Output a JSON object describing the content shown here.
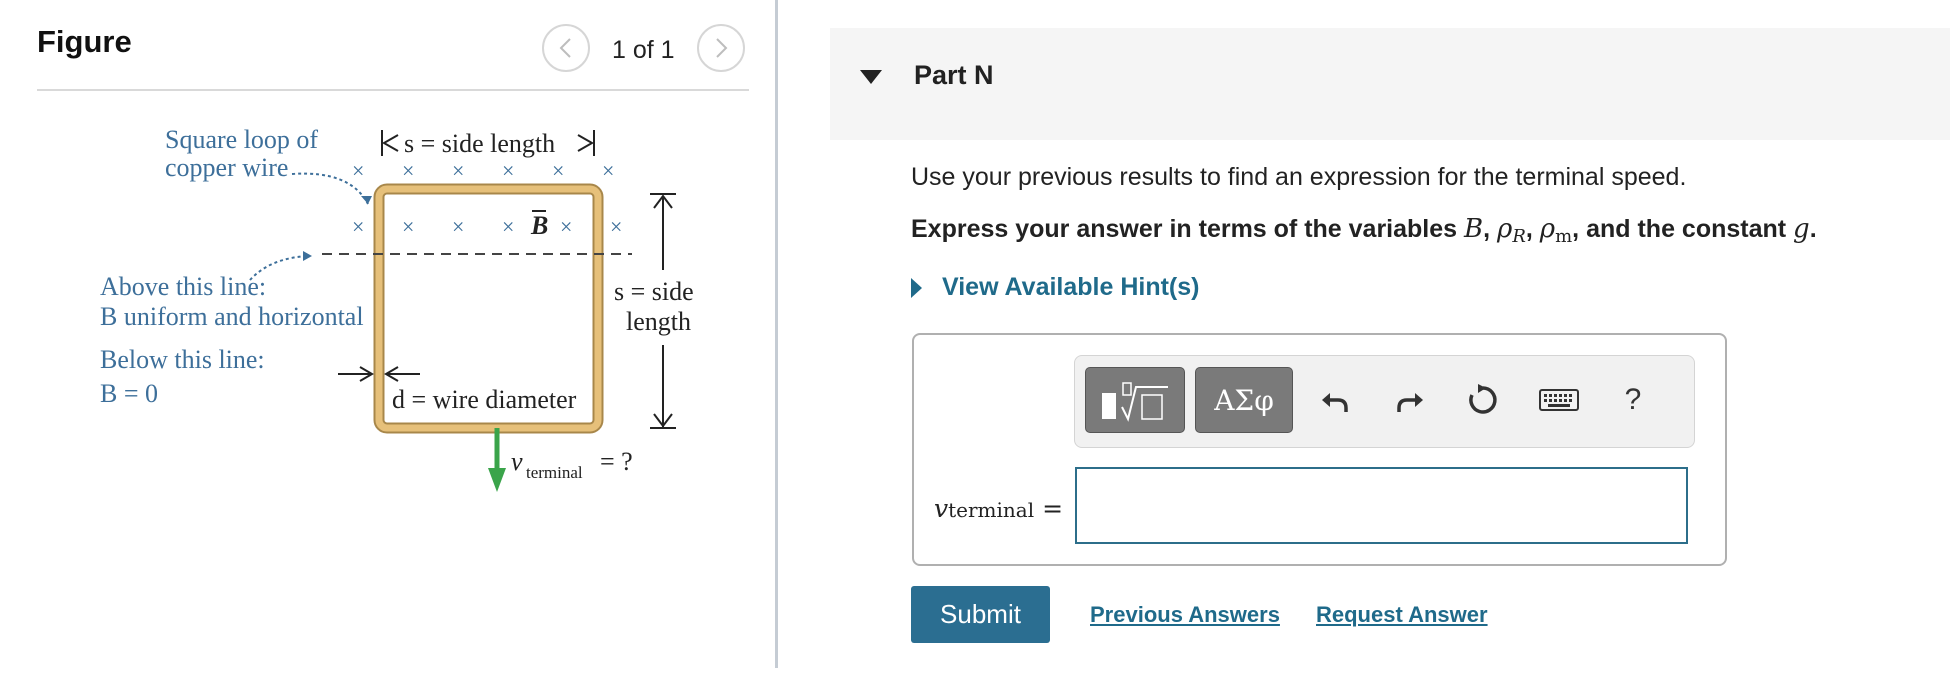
{
  "figure": {
    "title": "Figure",
    "pager": "1 of 1",
    "diagram": {
      "loop_label_line1": "Square loop of",
      "loop_label_line2": "copper wire",
      "side_length_label": "s = side length",
      "field_label": "B",
      "above_line1": "Above this line:",
      "above_line2": "B uniform and horizontal",
      "below_line1": "Below this line:",
      "below_line2": "B = 0",
      "side_label_line1": "s = side",
      "side_label_line2": "length",
      "diameter_label": "d = wire diameter",
      "velocity_label": "v",
      "velocity_sub": "terminal",
      "velocity_suffix": "= ?",
      "colors": {
        "diagram_text": "#3d6f9a",
        "loop_fill": "#e6c07a",
        "loop_edge": "#a8874a",
        "arrow_green": "#3aa44a"
      }
    }
  },
  "part": {
    "title": "Part N",
    "prompt": "Use your previous results to find an expression for the terminal speed.",
    "instruction_prefix": "Express your answer in terms of the variables",
    "instruction_suffix": "and the constant",
    "var_B": "B",
    "var_rho": "ρ",
    "sub_R": "R",
    "sub_m": "m",
    "var_g": "g",
    "hints_label": "View Available Hint(s)"
  },
  "toolbar": {
    "symbols_label": "ΑΣφ",
    "help_label": "?",
    "icons": [
      "template-icon",
      "symbols-icon",
      "undo-icon",
      "redo-icon",
      "reset-icon",
      "keyboard-icon",
      "help-icon"
    ]
  },
  "answer": {
    "label_var": "v",
    "label_sub": "terminal",
    "label_eq": "=",
    "value": ""
  },
  "actions": {
    "submit": "Submit",
    "previous_answers": "Previous Answers",
    "request_answer": "Request Answer"
  },
  "colors": {
    "link": "#1f6a8a",
    "submit_bg": "#2b6e91",
    "header_bg": "#f5f5f5"
  }
}
